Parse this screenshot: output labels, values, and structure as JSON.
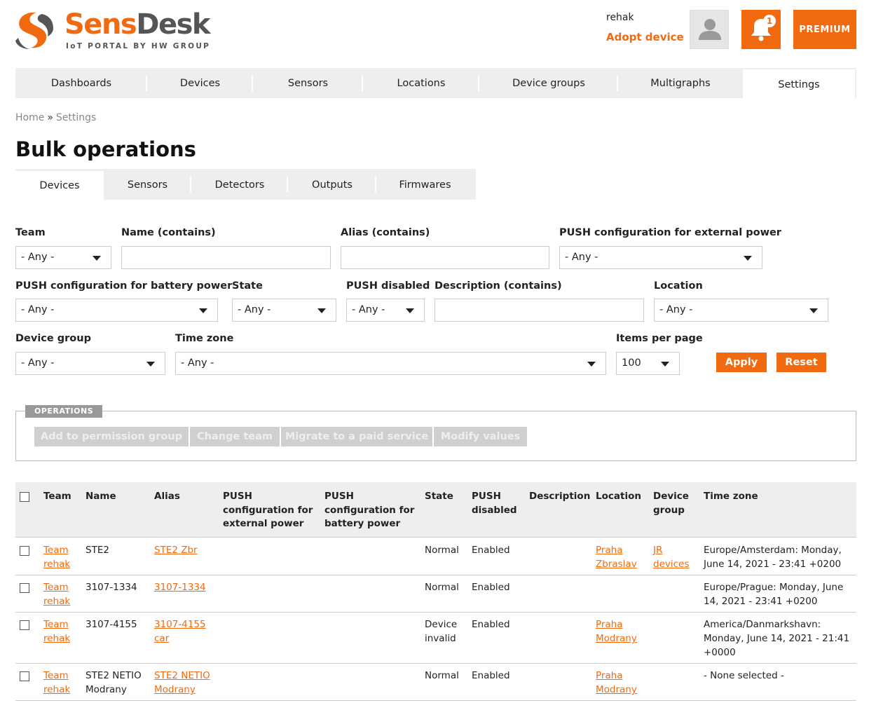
{
  "brand": {
    "name_part1": "Sens",
    "name_part2": "Desk",
    "tagline": "IoT PORTAL BY HW GROUP"
  },
  "header": {
    "username": "rehak",
    "adopt_label": "Adopt device",
    "notification_count": "1",
    "premium_label": "PREMIUM"
  },
  "nav": {
    "items": [
      "Dashboards",
      "Devices",
      "Sensors",
      "Locations",
      "Device groups",
      "Multigraphs",
      "Settings"
    ],
    "active": "Settings"
  },
  "breadcrumb": {
    "home": "Home",
    "sep": "»",
    "current": "Settings"
  },
  "page_title": "Bulk operations",
  "subtabs": {
    "items": [
      "Devices",
      "Sensors",
      "Detectors",
      "Outputs",
      "Firmwares"
    ],
    "active": "Devices"
  },
  "filters": {
    "team": {
      "label": "Team",
      "value": "- Any -"
    },
    "name": {
      "label": "Name (contains)",
      "value": ""
    },
    "alias": {
      "label": "Alias (contains)",
      "value": ""
    },
    "push_external": {
      "label": "PUSH configuration for external power",
      "value": "- Any -"
    },
    "push_battery": {
      "label": "PUSH configuration for battery power",
      "value": "- Any -"
    },
    "state": {
      "label": "State",
      "value": "- Any -"
    },
    "push_disabled": {
      "label": "PUSH disabled",
      "value": "- Any -"
    },
    "description": {
      "label": "Description (contains)",
      "value": ""
    },
    "location": {
      "label": "Location",
      "value": "- Any -"
    },
    "device_group": {
      "label": "Device group",
      "value": "- Any -"
    },
    "time_zone": {
      "label": "Time zone",
      "value": "- Any -"
    },
    "items_per_page": {
      "label": "Items per page",
      "value": "100"
    },
    "apply_label": "Apply",
    "reset_label": "Reset"
  },
  "operations": {
    "legend": "OPERATIONS",
    "buttons": [
      "Add to permission group",
      "Change team",
      "Migrate to a paid service",
      "Modify values"
    ]
  },
  "table": {
    "headers": {
      "team": "Team",
      "name": "Name",
      "alias": "Alias",
      "push_external": [
        "PUSH",
        "configuration for",
        "external power"
      ],
      "push_battery": [
        "PUSH",
        "configuration for",
        "battery power"
      ],
      "state": "State",
      "push_disabled": [
        "PUSH",
        "disabled"
      ],
      "description": "Description",
      "location": "Location",
      "device_group": [
        "Device",
        "group"
      ],
      "time_zone": "Time zone"
    },
    "rows": [
      {
        "team": [
          "Team",
          "rehak"
        ],
        "name": [
          "STE2"
        ],
        "alias": [
          "STE2 Zbr"
        ],
        "state": [
          "Normal"
        ],
        "push_disabled": "Enabled",
        "location": [
          "Praha",
          "Zbraslav"
        ],
        "device_group": [
          "JR",
          "devices"
        ],
        "time_zone": [
          "Europe/Amsterdam: Monday,",
          "June 14, 2021 - 23:41 +0200"
        ]
      },
      {
        "team": [
          "Team",
          "rehak"
        ],
        "name": [
          "3107-1334"
        ],
        "alias": [
          "3107-1334"
        ],
        "state": [
          "Normal"
        ],
        "push_disabled": "Enabled",
        "location": [],
        "device_group": [],
        "time_zone": [
          "Europe/Prague: Monday, June",
          "14, 2021 - 23:41 +0200"
        ]
      },
      {
        "team": [
          "Team",
          "rehak"
        ],
        "name": [
          "3107-4155"
        ],
        "alias": [
          "3107-4155",
          "car"
        ],
        "state": [
          "Device",
          "invalid"
        ],
        "push_disabled": "Enabled",
        "location": [
          "Praha",
          "Modrany"
        ],
        "device_group": [],
        "time_zone": [
          "America/Danmarkshavn:",
          "Monday, June 14, 2021 - 21:41",
          "+0000"
        ]
      },
      {
        "team": [
          "Team",
          "rehak"
        ],
        "name": [
          "STE2 NETIO",
          "Modrany"
        ],
        "alias": [
          "STE2 NETIO",
          "Modrany"
        ],
        "state": [
          "Normal"
        ],
        "push_disabled": "Enabled",
        "location": [
          "Praha",
          "Modrany"
        ],
        "device_group": [],
        "time_zone": [
          "- None selected -"
        ]
      }
    ]
  }
}
